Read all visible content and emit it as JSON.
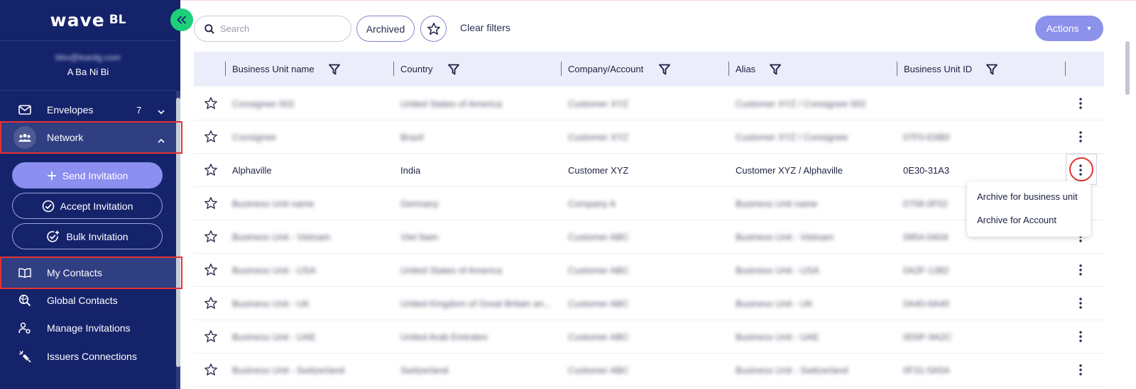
{
  "app": {
    "logo_main": "wave",
    "logo_sub": "BL"
  },
  "user": {
    "email": "bbo@leardg.com",
    "name": "A Ba Ni Bi"
  },
  "sidebar": {
    "items": [
      {
        "label": "Envelopes",
        "count": "7"
      },
      {
        "label": "Network"
      },
      {
        "label": "My Contacts"
      },
      {
        "label": "Global Contacts"
      },
      {
        "label": "Manage Invitations"
      },
      {
        "label": "Issuers Connections"
      }
    ],
    "buttons": {
      "send": "Send Invitation",
      "accept": "Accept Invitation",
      "bulk": "Bulk Invitation"
    }
  },
  "toolbar": {
    "search_placeholder": "Search",
    "archived_label": "Archived",
    "clear_filters_label": "Clear filters",
    "actions_label": "Actions"
  },
  "table": {
    "columns": [
      "Business Unit name",
      "Country",
      "Company/Account",
      "Alias",
      "Business Unit ID"
    ],
    "rows": [
      {
        "name": "Consignee 002",
        "country": "United States of America",
        "company": "Customer XYZ",
        "alias": "Customer XYZ / Consignee 002",
        "id": "",
        "blurred": true
      },
      {
        "name": "Consignee",
        "country": "Brazil",
        "company": "Customer XYZ",
        "alias": "Customer XYZ / Consignee",
        "id": "07F0-E6B0",
        "blurred": true
      },
      {
        "name": "Alphaville",
        "country": "India",
        "company": "Customer XYZ",
        "alias": "Customer XYZ / Alphaville",
        "id": "0E30-31A3",
        "blurred": false
      },
      {
        "name": "Business Unit name",
        "country": "Germany",
        "company": "Company A",
        "alias": "Business Unit name",
        "id": "0758-0F52",
        "blurred": true
      },
      {
        "name": "Business Unit - Vietnam",
        "country": "Viet Nam",
        "company": "Customer ABC",
        "alias": "Business Unit - Vietnam",
        "id": "0954-0A04",
        "blurred": true
      },
      {
        "name": "Business Unit - USA",
        "country": "United States of America",
        "company": "Customer ABC",
        "alias": "Business Unit - USA",
        "id": "0A2F-1382",
        "blurred": true
      },
      {
        "name": "Business Unit - UK",
        "country": "United Kingdom of Great Britain an...",
        "company": "Customer ABC",
        "alias": "Business Unit - UK",
        "id": "0A40-6A40",
        "blurred": true
      },
      {
        "name": "Business Unit - UAE",
        "country": "United Arab Emirates",
        "company": "Customer ABC",
        "alias": "Business Unit - UAE",
        "id": "0D0F-9A2C",
        "blurred": true
      },
      {
        "name": "Business Unit - Switzerland",
        "country": "Switzerland",
        "company": "Customer ABC",
        "alias": "Business Unit - Switzerland",
        "id": "0F31-5A5A",
        "blurred": true
      }
    ]
  },
  "row_menu": {
    "items": [
      "Archive for business unit",
      "Archive for Account"
    ]
  },
  "colors": {
    "sidebar_bg": "#15236b",
    "accent": "#8b8ff0",
    "green": "#1dd17a",
    "highlight_red": "#e53232"
  }
}
